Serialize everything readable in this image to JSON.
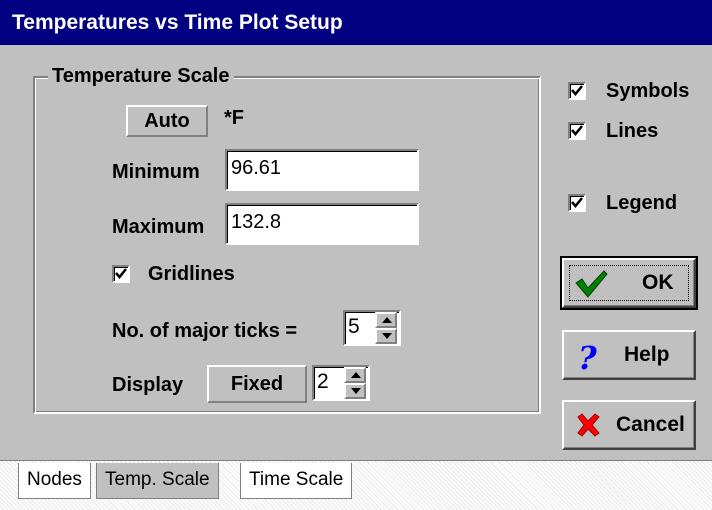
{
  "window": {
    "title": "Temperatures vs Time Plot Setup"
  },
  "temperature_scale": {
    "group_label": "Temperature Scale",
    "auto_label": "Auto",
    "unit_label": "*F",
    "minimum_label": "Minimum",
    "minimum_value": "96.61",
    "maximum_label": "Maximum",
    "maximum_value": "132.8",
    "gridlines_label": "Gridlines",
    "gridlines_checked": true,
    "major_ticks_label": "No. of major ticks =",
    "major_ticks_value": "5",
    "display_label": "Display",
    "display_mode": "Fixed",
    "display_decimals": "2"
  },
  "options": {
    "symbols_label": "Symbols",
    "symbols_checked": true,
    "lines_label": "Lines",
    "lines_checked": true,
    "legend_label": "Legend",
    "legend_checked": true
  },
  "buttons": {
    "ok_label": "OK",
    "help_label": "Help",
    "cancel_label": "Cancel"
  },
  "tabs": [
    {
      "label": "Nodes"
    },
    {
      "label": "Temp. Scale"
    },
    {
      "label": "Time Scale"
    }
  ],
  "active_tab": "Temp. Scale",
  "icons": {
    "ok": "green-checkmark-icon",
    "help": "blue-question-mark-icon",
    "cancel": "red-x-icon"
  },
  "colors": {
    "titlebar": "#000080",
    "face": "#c0c0c0",
    "ok_check": "#008000",
    "help_mark": "#0000ff",
    "cancel_x": "#ff0000"
  }
}
